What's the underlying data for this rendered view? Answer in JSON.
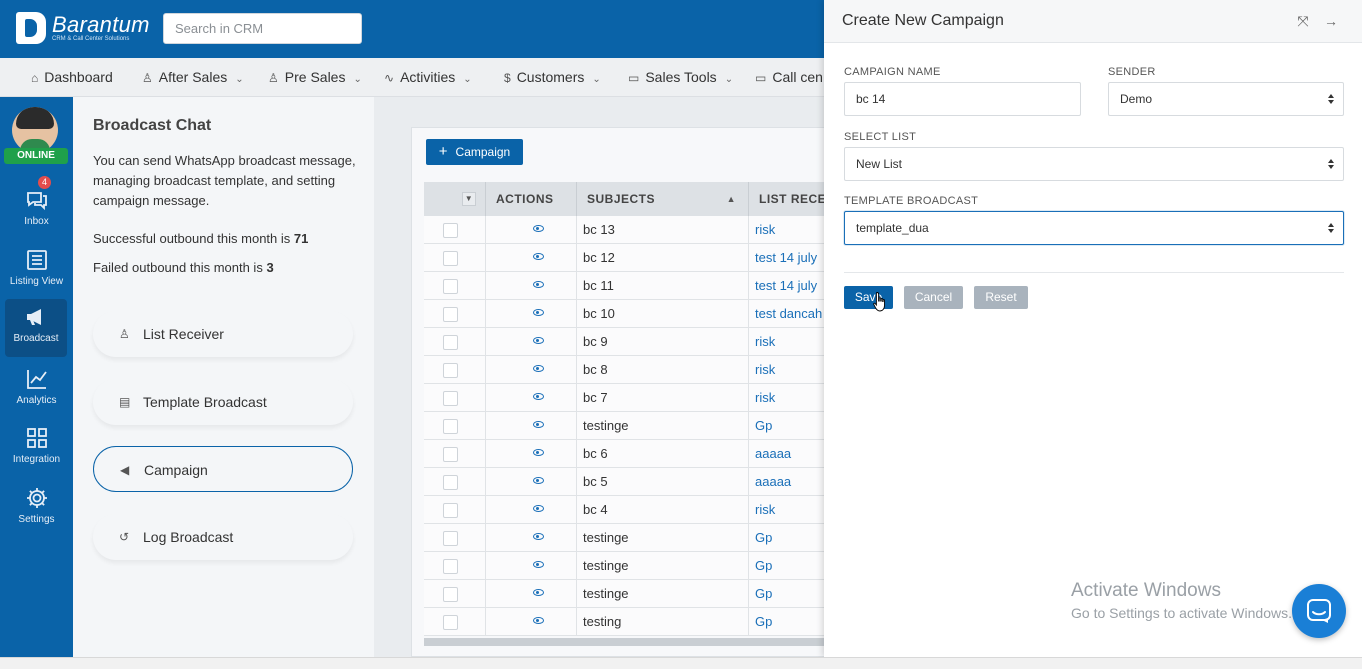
{
  "header": {
    "brand": "Barantum",
    "tagline": "CRM & Call Center Solutions",
    "search_placeholder": "Search in CRM"
  },
  "nav": [
    {
      "label": "Dashboard",
      "icon": "home-icon"
    },
    {
      "label": "After Sales",
      "icon": "user-icon"
    },
    {
      "label": "Pre Sales",
      "icon": "users-icon"
    },
    {
      "label": "Activities",
      "icon": "activity-icon"
    },
    {
      "label": "Customers",
      "icon": "dollar-icon"
    },
    {
      "label": "Sales Tools",
      "icon": "folder-icon"
    },
    {
      "label": "Call cen",
      "icon": "folder-icon"
    }
  ],
  "sidebar": {
    "status": "ONLINE",
    "inbox_badge": "4",
    "items": [
      {
        "label": "Inbox",
        "icon": "inbox-icon"
      },
      {
        "label": "Listing View",
        "icon": "list-icon"
      },
      {
        "label": "Broadcast",
        "icon": "megaphone-icon"
      },
      {
        "label": "Analytics",
        "icon": "chart-line-icon"
      },
      {
        "label": "Integration",
        "icon": "grid-icon"
      },
      {
        "label": "Settings",
        "icon": "gear-icon"
      }
    ]
  },
  "broadcast": {
    "title": "Broadcast Chat",
    "description": "You can send WhatsApp broadcast message, managing broadcast template, and setting campaign message.",
    "success_text": "Successful outbound this month is ",
    "success_count": "71",
    "failed_text": "Failed outbound this month is ",
    "failed_count": "3",
    "menu": [
      {
        "label": "List Receiver",
        "icon": "user-icon"
      },
      {
        "label": "Template Broadcast",
        "icon": "calendar-icon"
      },
      {
        "label": "Campaign",
        "icon": "megaphone-icon"
      },
      {
        "label": "Log Broadcast",
        "icon": "history-icon"
      }
    ]
  },
  "table": {
    "add_button": "Campaign",
    "columns": [
      "ACTIONS",
      "SUBJECTS",
      "LIST RECEIV"
    ],
    "rows": [
      {
        "subject": "bc 13",
        "list": "risk"
      },
      {
        "subject": "bc 12",
        "list": "test 14 july"
      },
      {
        "subject": "bc 11",
        "list": "test 14 july"
      },
      {
        "subject": "bc 10",
        "list": "test dancah"
      },
      {
        "subject": "bc 9",
        "list": "risk"
      },
      {
        "subject": "bc 8",
        "list": "risk"
      },
      {
        "subject": "bc 7",
        "list": "risk"
      },
      {
        "subject": "testinge",
        "list": "Gp"
      },
      {
        "subject": "bc 6",
        "list": "aaaaa"
      },
      {
        "subject": "bc 5",
        "list": "aaaaa"
      },
      {
        "subject": "bc 4",
        "list": "risk"
      },
      {
        "subject": "testinge",
        "list": "Gp"
      },
      {
        "subject": "testinge",
        "list": "Gp"
      },
      {
        "subject": "testinge",
        "list": "Gp"
      },
      {
        "subject": "testing",
        "list": "Gp"
      }
    ]
  },
  "drawer": {
    "title": "Create New Campaign",
    "campaign_name_label": "CAMPAIGN NAME",
    "campaign_name_value": "bc 14",
    "sender_label": "SENDER",
    "sender_value": "Demo",
    "select_list_label": "SELECT LIST",
    "select_list_value": "New List",
    "template_label": "TEMPLATE BROADCAST",
    "template_value": "template_dua",
    "save": "Save",
    "cancel": "Cancel",
    "reset": "Reset"
  },
  "watermark": {
    "line1": "Activate Windows",
    "line2": "Go to Settings to activate Windows."
  },
  "colors": {
    "primary": "#0a63a8",
    "link": "#1a6fb8",
    "online": "#1fa04a",
    "muted_button": "#a9b3bd"
  }
}
